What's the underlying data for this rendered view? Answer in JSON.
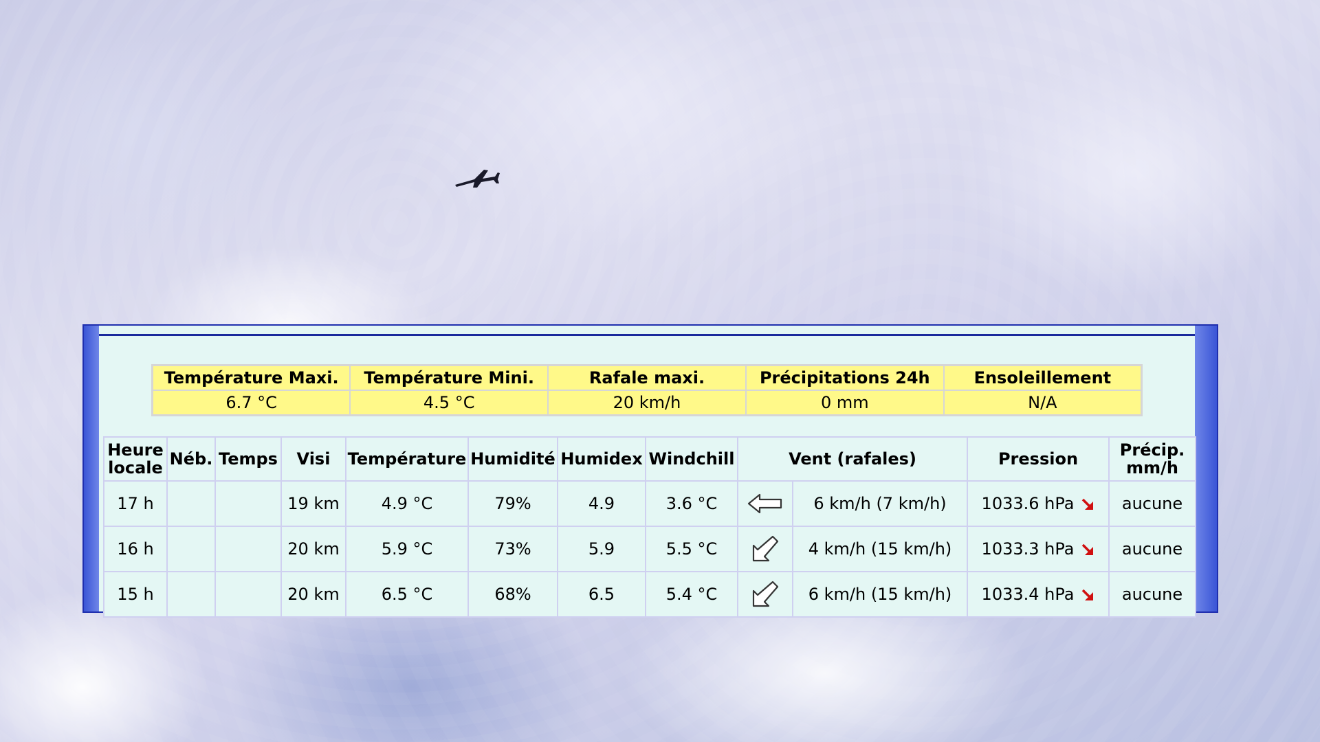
{
  "summary": {
    "headers": [
      "Température Maxi.",
      "Température Mini.",
      "Rafale maxi.",
      "Précipitations 24h",
      "Ensoleillement"
    ],
    "values": [
      "6.7 °C",
      "4.5 °C",
      "20 km/h",
      "0 mm",
      "N/A"
    ]
  },
  "table": {
    "headers": {
      "heure_line1": "Heure",
      "heure_line2": "locale",
      "neb": "Néb.",
      "temps": "Temps",
      "visi": "Visi",
      "temperature": "Température",
      "humidite": "Humidité",
      "humidex": "Humidex",
      "windchill": "Windchill",
      "vent": "Vent (rafales)",
      "pression": "Pression",
      "precip_line1": "Précip.",
      "precip_line2": "mm/h"
    },
    "rows": [
      {
        "heure": "17 h",
        "neb": "",
        "temps": "",
        "visi": "19 km",
        "temperature": "4.9 °C",
        "humidite": "79%",
        "humidex": "4.9",
        "windchill": "3.6 °C",
        "wind_direction_icon": "arrow-left-icon",
        "vent": "6 km/h (7 km/h)",
        "pression": "1033.6 hPa",
        "pressure_trend_icon": "arrow-down-right-icon",
        "precip": "aucune"
      },
      {
        "heure": "16 h",
        "neb": "",
        "temps": "",
        "visi": "20 km",
        "temperature": "5.9 °C",
        "humidite": "73%",
        "humidex": "5.9",
        "windchill": "5.5 °C",
        "wind_direction_icon": "arrow-down-left-icon",
        "vent": "4 km/h (15 km/h)",
        "pression": "1033.3 hPa",
        "pressure_trend_icon": "arrow-down-right-icon",
        "precip": "aucune"
      },
      {
        "heure": "15 h",
        "neb": "",
        "temps": "",
        "visi": "20 km",
        "temperature": "6.5 °C",
        "humidite": "68%",
        "humidex": "6.5",
        "windchill": "5.4 °C",
        "wind_direction_icon": "arrow-down-left-icon",
        "vent": "6 km/h (15 km/h)",
        "pression": "1033.4 hPa",
        "pressure_trend_icon": "arrow-down-right-icon",
        "precip": "aucune"
      }
    ]
  },
  "colors": {
    "panel_bg": "#e4f7f4",
    "summary_bg": "#fff989",
    "border_blue": "#1f2fae",
    "trend_red": "#d01010"
  }
}
